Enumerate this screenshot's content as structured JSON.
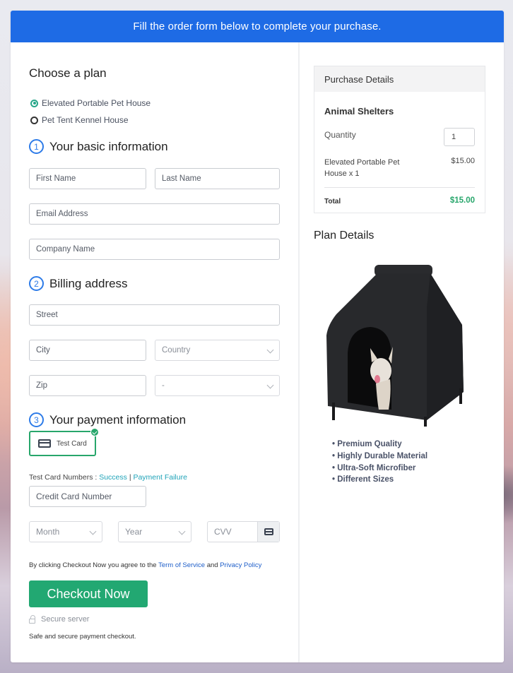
{
  "banner": {
    "text": "Fill the order form below to complete your purchase."
  },
  "plan": {
    "heading": "Choose a plan",
    "options": [
      {
        "label": "Elevated Portable Pet House",
        "selected": true
      },
      {
        "label": "Pet Tent Kennel House",
        "selected": false
      }
    ]
  },
  "basic_info": {
    "number": "1",
    "heading": "Your basic information",
    "first_name_placeholder": "First Name",
    "last_name_placeholder": "Last Name",
    "email_placeholder": "Email Address",
    "company_placeholder": "Company Name"
  },
  "billing": {
    "number": "2",
    "heading": "Billing address",
    "street_placeholder": "Street",
    "city_placeholder": "City",
    "country_selected": "Country",
    "zip_placeholder": "Zip",
    "state_selected": "-"
  },
  "payment": {
    "number": "3",
    "heading": "Your payment information",
    "method_label": "Test Card",
    "test_numbers_label": "Test Card Numbers :",
    "success_link": "Success",
    "separator": "|",
    "failure_link": "Payment Failure",
    "card_number_placeholder": "Credit Card Number",
    "month_selected": "Month",
    "year_selected": "Year",
    "cvv_placeholder": "CVV"
  },
  "terms": {
    "prefix": "By clicking Checkout Now you agree to the",
    "tos_link": "Term of Service",
    "and": "and",
    "privacy_link": "Privacy Policy"
  },
  "checkout": {
    "button_label": "Checkout Now",
    "secure_label": "Secure server",
    "safe_text": "Safe and secure payment checkout."
  },
  "purchase_details": {
    "heading": "Purchase Details",
    "product_group": "Animal Shelters",
    "quantity_label": "Quantity",
    "quantity_value": "1",
    "item_label": "Elevated Portable Pet House x 1",
    "item_price": "$15.00",
    "total_label": "Total",
    "total_value": "$15.00"
  },
  "plan_details": {
    "heading": "Plan Details",
    "image_alt": "Black elevated pet tent house with a french bulldog",
    "features": [
      "Premium Quality",
      "Highly Durable Material",
      "Ultra-Soft Microfiber",
      "Different Sizes"
    ]
  },
  "colors": {
    "banner": "#1e6be5",
    "accent_green": "#27a66b",
    "checkout_green": "#22a872",
    "step_blue": "#2d7be8",
    "link_teal": "#1fa3b8",
    "link_blue": "#1f5fc9"
  }
}
